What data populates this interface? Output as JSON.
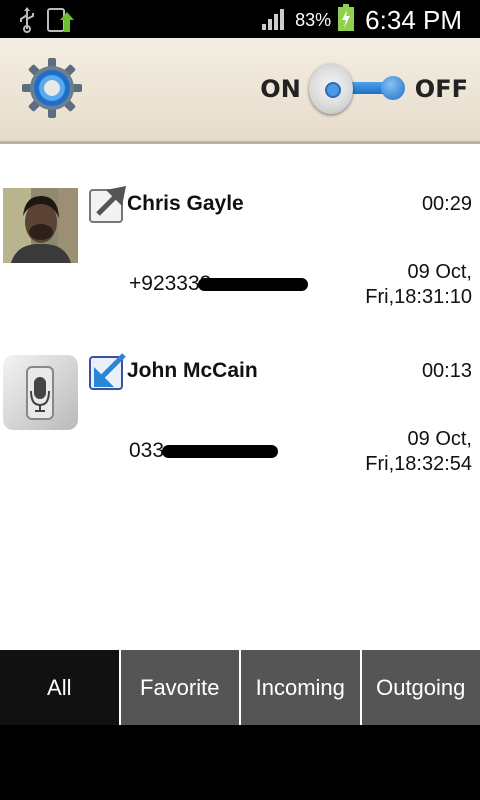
{
  "status_bar": {
    "battery_percent": "83%",
    "time": "6:34 PM",
    "icons": [
      "usb-icon",
      "download-icon",
      "signal-icon",
      "battery-charging-icon"
    ]
  },
  "header": {
    "settings_icon": "gear-icon",
    "toggle": {
      "on_label": "ON",
      "off_label": "OFF",
      "state": "on"
    }
  },
  "calls": [
    {
      "name": "Chris Gayle",
      "duration": "00:29",
      "number": "+923333",
      "date_line1": "09 Oct,",
      "date_line2": "Fri,18:31:10",
      "direction": "outgoing",
      "avatar": "contact-photo"
    },
    {
      "name": "John McCain",
      "duration": "00:13",
      "number": "033",
      "date_line1": "09 Oct,",
      "date_line2": "Fri,18:32:54",
      "direction": "incoming",
      "avatar": "voice-recorder-icon"
    }
  ],
  "tabs": [
    {
      "label": "All",
      "active": true
    },
    {
      "label": "Favorite",
      "active": false
    },
    {
      "label": "Incoming",
      "active": false
    },
    {
      "label": "Outgoing",
      "active": false
    }
  ],
  "colors": {
    "accent_blue": "#1d6fc6",
    "tab_active": "#111111",
    "tab_inactive": "#555555"
  }
}
